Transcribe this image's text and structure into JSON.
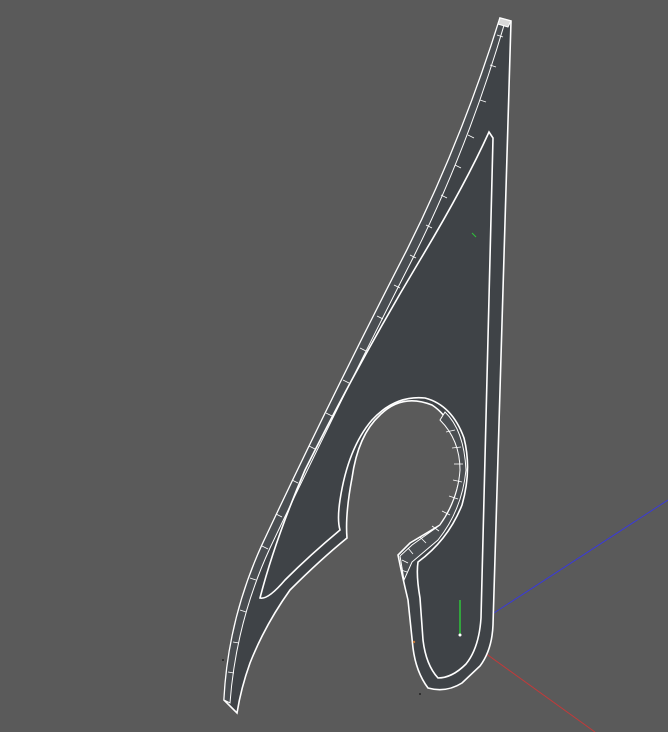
{
  "viewport": {
    "background_color": "#5a5a5a",
    "model_face_color": "#3f4347",
    "model_edge_color": "#ffffff",
    "axis_x_color": "#c23a3a",
    "axis_y_color": "#2ec43a",
    "axis_z_color": "#3a3ad8",
    "icons": [
      "axis-gizmo-icon"
    ]
  }
}
